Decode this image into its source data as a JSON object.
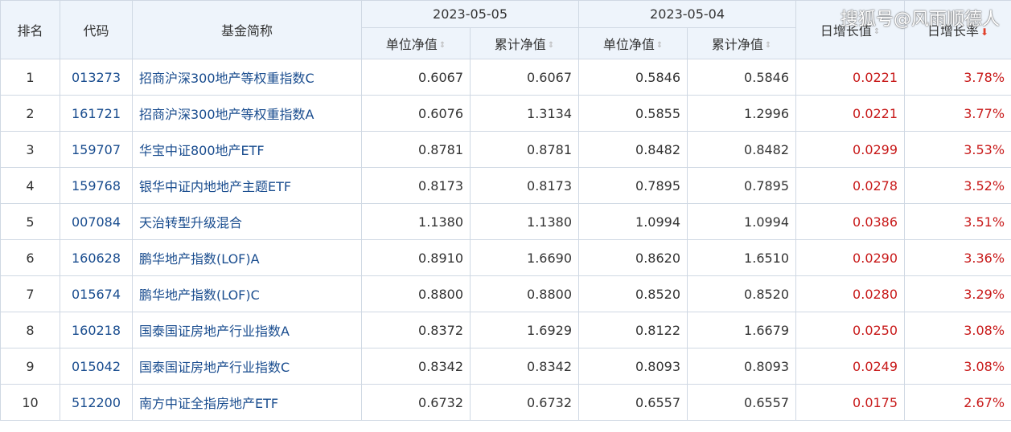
{
  "headers": {
    "rank": "排名",
    "code": "代码",
    "name": "基金简称",
    "date1": "2023-05-05",
    "date2": "2023-05-04",
    "unit_nav": "单位净值",
    "acc_nav": "累计净值",
    "daily_growth_value": "日增长值",
    "daily_growth_rate": "日增长率"
  },
  "watermark": "搜狐号@风雨顺德人",
  "colors": {
    "link": "#1a4d8f",
    "positive": "#c81a1a",
    "header_bg": "#eef4fb"
  },
  "rows": [
    {
      "rank": "1",
      "code": "013273",
      "name": "招商沪深300地产等权重指数C",
      "unit1": "0.6067",
      "acc1": "0.6067",
      "unit2": "0.5846",
      "acc2": "0.5846",
      "gv": "0.0221",
      "gr": "3.78%"
    },
    {
      "rank": "2",
      "code": "161721",
      "name": "招商沪深300地产等权重指数A",
      "unit1": "0.6076",
      "acc1": "1.3134",
      "unit2": "0.5855",
      "acc2": "1.2996",
      "gv": "0.0221",
      "gr": "3.77%"
    },
    {
      "rank": "3",
      "code": "159707",
      "name": "华宝中证800地产ETF",
      "unit1": "0.8781",
      "acc1": "0.8781",
      "unit2": "0.8482",
      "acc2": "0.8482",
      "gv": "0.0299",
      "gr": "3.53%"
    },
    {
      "rank": "4",
      "code": "159768",
      "name": "银华中证内地地产主题ETF",
      "unit1": "0.8173",
      "acc1": "0.8173",
      "unit2": "0.7895",
      "acc2": "0.7895",
      "gv": "0.0278",
      "gr": "3.52%"
    },
    {
      "rank": "5",
      "code": "007084",
      "name": "天治转型升级混合",
      "unit1": "1.1380",
      "acc1": "1.1380",
      "unit2": "1.0994",
      "acc2": "1.0994",
      "gv": "0.0386",
      "gr": "3.51%"
    },
    {
      "rank": "6",
      "code": "160628",
      "name": "鹏华地产指数(LOF)A",
      "unit1": "0.8910",
      "acc1": "1.6690",
      "unit2": "0.8620",
      "acc2": "1.6510",
      "gv": "0.0290",
      "gr": "3.36%"
    },
    {
      "rank": "7",
      "code": "015674",
      "name": "鹏华地产指数(LOF)C",
      "unit1": "0.8800",
      "acc1": "0.8800",
      "unit2": "0.8520",
      "acc2": "0.8520",
      "gv": "0.0280",
      "gr": "3.29%"
    },
    {
      "rank": "8",
      "code": "160218",
      "name": "国泰国证房地产行业指数A",
      "unit1": "0.8372",
      "acc1": "1.6929",
      "unit2": "0.8122",
      "acc2": "1.6679",
      "gv": "0.0250",
      "gr": "3.08%"
    },
    {
      "rank": "9",
      "code": "015042",
      "name": "国泰国证房地产行业指数C",
      "unit1": "0.8342",
      "acc1": "0.8342",
      "unit2": "0.8093",
      "acc2": "0.8093",
      "gv": "0.0249",
      "gr": "3.08%"
    },
    {
      "rank": "10",
      "code": "512200",
      "name": "南方中证全指房地产ETF",
      "unit1": "0.6732",
      "acc1": "0.6732",
      "unit2": "0.6557",
      "acc2": "0.6557",
      "gv": "0.0175",
      "gr": "2.67%"
    }
  ]
}
